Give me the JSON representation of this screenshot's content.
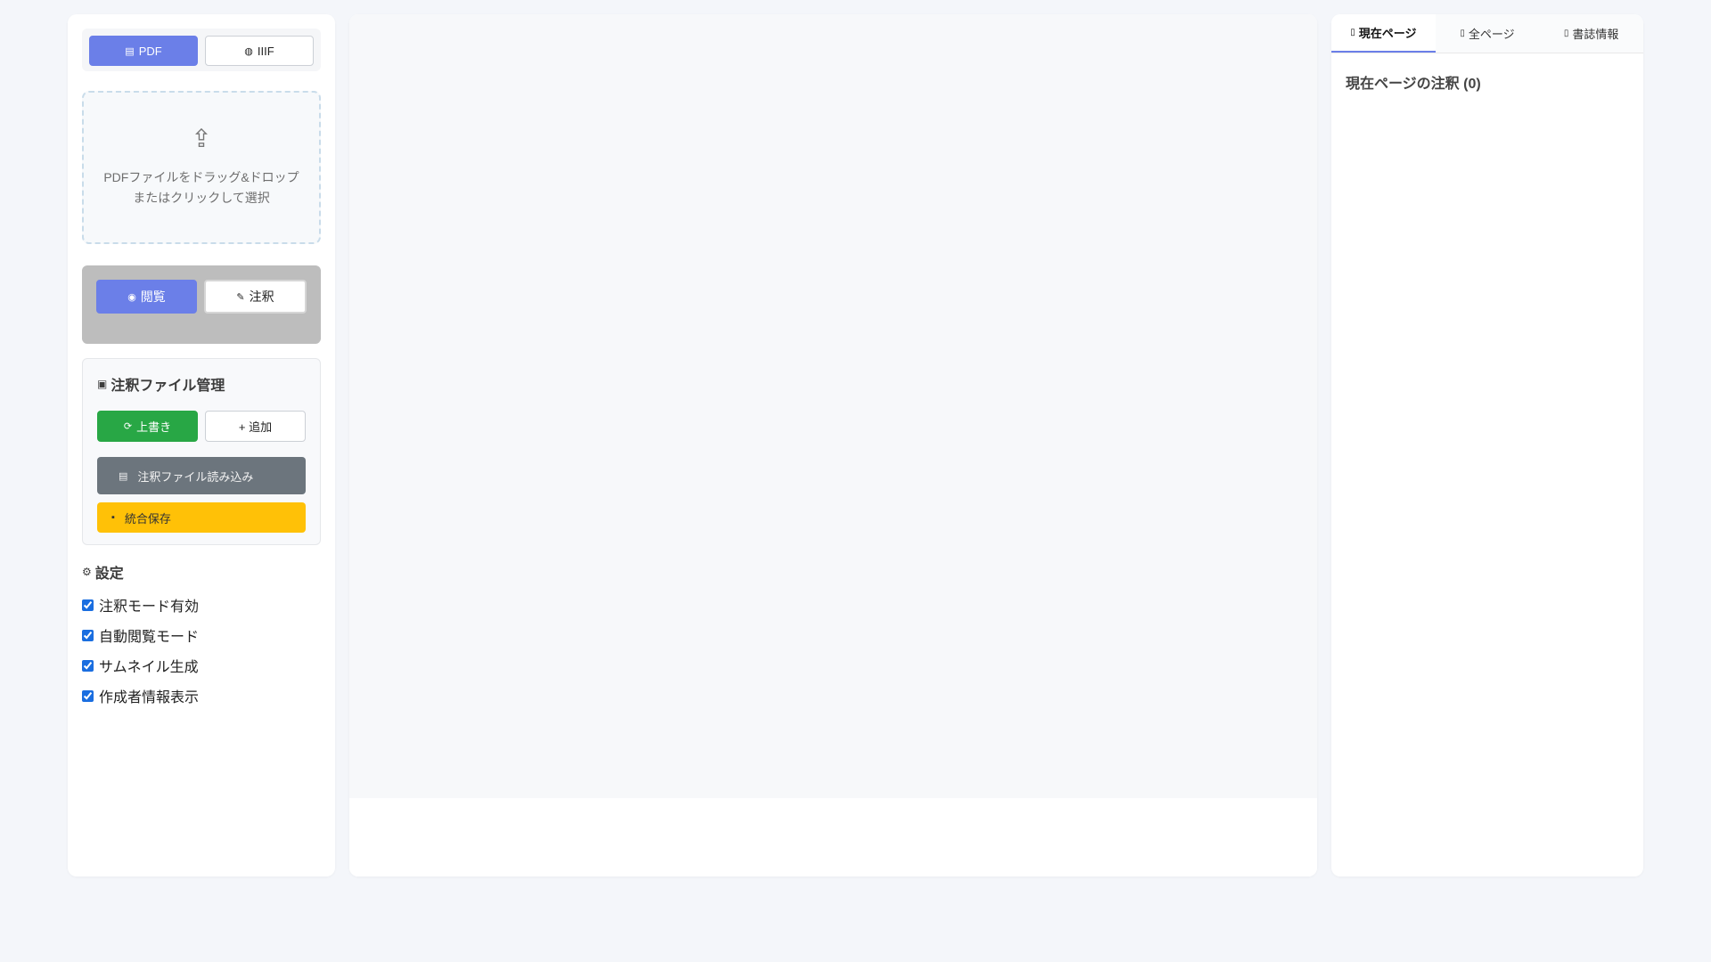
{
  "source_toggle": {
    "pdf_label": "PDF",
    "iiif_label": "IIIF"
  },
  "dropzone": {
    "line1": "PDFファイルをドラッグ&ドロップ",
    "line2": "またはクリックして選択",
    "icon": "upload-icon"
  },
  "mode": {
    "view_label": "閲覧",
    "annotate_label": "注釈"
  },
  "annotation_files": {
    "title": "注釈ファイル管理",
    "overwrite_label": "上書き",
    "add_label": "+ 追加",
    "load_label": "注釈ファイル読み込み",
    "save_label": "統合保存"
  },
  "settings": {
    "title": "設定",
    "items": [
      {
        "label": "注釈モード有効",
        "checked": true
      },
      {
        "label": "自動閲覧モード",
        "checked": true
      },
      {
        "label": "サムネイル生成",
        "checked": true
      },
      {
        "label": "作成者情報表示",
        "checked": true
      }
    ]
  },
  "right_panel": {
    "tabs": [
      {
        "label": "現在ページ",
        "active": true
      },
      {
        "label": "全ページ",
        "active": false
      },
      {
        "label": "書誌情報",
        "active": false
      }
    ],
    "heading": "現在ページの注釈 (0)"
  },
  "colors": {
    "primary": "#6b7fe8",
    "success": "#28a745",
    "gray": "#6c757d",
    "warning": "#ffc107"
  }
}
